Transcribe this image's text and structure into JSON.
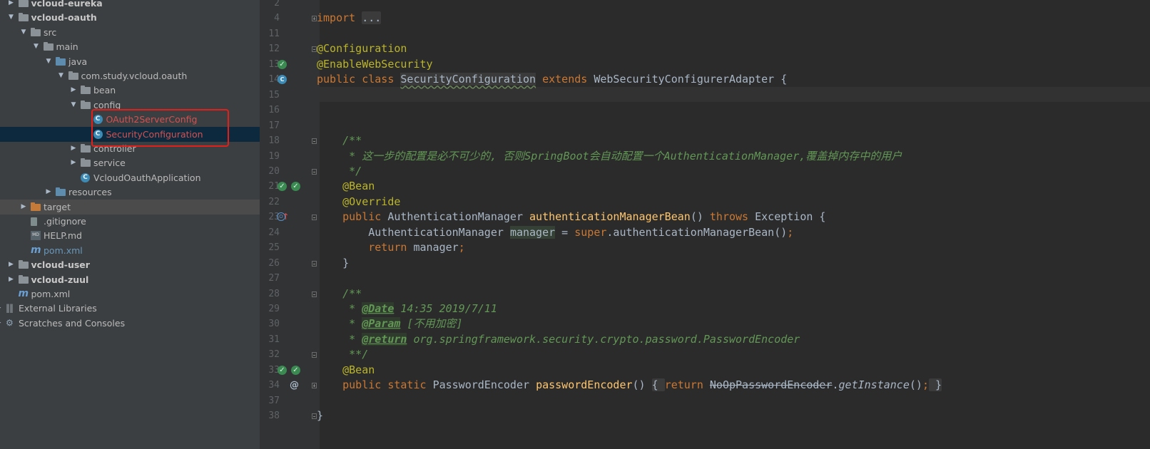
{
  "project_tree": {
    "items": [
      {
        "label": "vcloud-eureka",
        "depth": 0,
        "expanded": false,
        "icon": "module-folder-icon",
        "bold": true
      },
      {
        "label": "vcloud-oauth",
        "depth": 0,
        "expanded": true,
        "icon": "module-folder-icon",
        "bold": true
      },
      {
        "label": "src",
        "depth": 1,
        "expanded": true,
        "icon": "folder-icon"
      },
      {
        "label": "main",
        "depth": 2,
        "expanded": true,
        "icon": "folder-icon"
      },
      {
        "label": "java",
        "depth": 3,
        "expanded": true,
        "icon": "source-folder-icon"
      },
      {
        "label": "com.study.vcloud.oauth",
        "depth": 4,
        "expanded": true,
        "icon": "package-icon"
      },
      {
        "label": "bean",
        "depth": 5,
        "expanded": false,
        "icon": "package-icon"
      },
      {
        "label": "config",
        "depth": 5,
        "expanded": true,
        "icon": "package-icon"
      },
      {
        "label": "OAuth2ServerConfig",
        "depth": 6,
        "icon": "class-icon",
        "modified": true
      },
      {
        "label": "SecurityConfiguration",
        "depth": 6,
        "icon": "class-icon",
        "modified": true,
        "selected": true
      },
      {
        "label": "controller",
        "depth": 5,
        "expanded": false,
        "icon": "package-icon"
      },
      {
        "label": "service",
        "depth": 5,
        "expanded": false,
        "icon": "package-icon"
      },
      {
        "label": "VcloudOauthApplication",
        "depth": 5,
        "icon": "spring-boot-class-icon"
      },
      {
        "label": "resources",
        "depth": 3,
        "expanded": false,
        "icon": "resources-folder-icon"
      },
      {
        "label": "target",
        "depth": 1,
        "expanded": false,
        "icon": "excluded-folder-icon",
        "highlighted": true
      },
      {
        "label": ".gitignore",
        "depth": 1,
        "icon": "text-file-icon"
      },
      {
        "label": "HELP.md",
        "depth": 1,
        "icon": "markdown-file-icon"
      },
      {
        "label": "pom.xml",
        "depth": 1,
        "icon": "maven-icon",
        "blue": true
      },
      {
        "label": "vcloud-user",
        "depth": 0,
        "expanded": false,
        "icon": "module-folder-icon",
        "bold": true
      },
      {
        "label": "vcloud-zuul",
        "depth": 0,
        "expanded": false,
        "icon": "module-folder-icon",
        "bold": true
      },
      {
        "label": "pom.xml",
        "depth": 0,
        "icon": "maven-icon"
      },
      {
        "label": "External Libraries",
        "depth": -1,
        "expanded": false,
        "icon": "libraries-icon"
      },
      {
        "label": "Scratches and Consoles",
        "depth": -1,
        "expanded": false,
        "icon": "scratches-icon"
      }
    ]
  },
  "editor": {
    "lines": [
      {
        "num": "2",
        "code": []
      },
      {
        "num": "4",
        "code": [
          [
            "kw",
            "import "
          ],
          [
            "fold",
            "..."
          ]
        ],
        "fold": "plus"
      },
      {
        "num": "11",
        "code": []
      },
      {
        "num": "12",
        "code": [
          [
            "ann",
            "@Configuration"
          ]
        ],
        "fold": "minus"
      },
      {
        "num": "13",
        "code": [
          [
            "ann",
            "@EnableWebSecurity"
          ]
        ],
        "gutter": [
          "bean"
        ]
      },
      {
        "num": "14",
        "code": [
          [
            "kw",
            "public class "
          ],
          [
            "ul",
            "SecurityConfiguration"
          ],
          [
            "kw",
            " extends "
          ],
          [
            "t",
            "WebSecurityConfigurerAdapter {"
          ]
        ],
        "gutter": [
          "cls"
        ],
        "current": true
      },
      {
        "num": "15",
        "code": []
      },
      {
        "num": "16",
        "code": []
      },
      {
        "num": "17",
        "code": []
      },
      {
        "num": "18",
        "code": [
          [
            "t",
            "    "
          ],
          [
            "c",
            "/**"
          ]
        ],
        "fold": "minus"
      },
      {
        "num": "19",
        "code": [
          [
            "t",
            "     "
          ],
          [
            "c",
            "* 这一步的配置是必不可少的, 否则SpringBoot会自动配置一个AuthenticationManager,覆盖掉内存中的用户"
          ]
        ]
      },
      {
        "num": "20",
        "code": [
          [
            "t",
            "     "
          ],
          [
            "c",
            "*/"
          ]
        ],
        "fold": "minus"
      },
      {
        "num": "21",
        "code": [
          [
            "t",
            "    "
          ],
          [
            "ann",
            "@Bean"
          ]
        ],
        "gutter": [
          "bean",
          "bean2"
        ]
      },
      {
        "num": "22",
        "code": [
          [
            "t",
            "    "
          ],
          [
            "ann",
            "@Override"
          ]
        ]
      },
      {
        "num": "23",
        "code": [
          [
            "t",
            "    "
          ],
          [
            "kw",
            "public "
          ],
          [
            "t",
            "AuthenticationManager "
          ],
          [
            "m",
            "authenticationManagerBean"
          ],
          [
            "t",
            "() "
          ],
          [
            "kw",
            "throws "
          ],
          [
            "t",
            "Exception {"
          ]
        ],
        "gutter": [
          "ov",
          "up"
        ],
        "fold": "minus"
      },
      {
        "num": "24",
        "code": [
          [
            "t",
            "        AuthenticationManager "
          ],
          [
            "hv",
            "manager"
          ],
          [
            "t",
            " = "
          ],
          [
            "kw",
            "super"
          ],
          [
            "t",
            ".authenticationManagerBean()"
          ],
          [
            "kw",
            ";"
          ]
        ]
      },
      {
        "num": "25",
        "code": [
          [
            "t",
            "        "
          ],
          [
            "kw",
            "return "
          ],
          [
            "t",
            "manager"
          ],
          [
            "kw",
            ";"
          ]
        ]
      },
      {
        "num": "26",
        "code": [
          [
            "t",
            "    }"
          ]
        ],
        "fold": "minus"
      },
      {
        "num": "27",
        "code": []
      },
      {
        "num": "28",
        "code": [
          [
            "t",
            "    "
          ],
          [
            "c",
            "/**"
          ]
        ],
        "fold": "minus"
      },
      {
        "num": "29",
        "code": [
          [
            "t",
            "     "
          ],
          [
            "c",
            "* "
          ],
          [
            "tag",
            "@Date"
          ],
          [
            "c",
            " 14:35 2019/7/11"
          ]
        ]
      },
      {
        "num": "30",
        "code": [
          [
            "t",
            "     "
          ],
          [
            "c",
            "* "
          ],
          [
            "tag",
            "@Param"
          ],
          [
            "c",
            " [不用加密]"
          ]
        ]
      },
      {
        "num": "31",
        "code": [
          [
            "t",
            "     "
          ],
          [
            "c",
            "* "
          ],
          [
            "tag",
            "@return"
          ],
          [
            "c",
            " org.springframework.security.crypto.password.PasswordEncoder"
          ]
        ]
      },
      {
        "num": "32",
        "code": [
          [
            "t",
            "     "
          ],
          [
            "c",
            "**/"
          ]
        ],
        "fold": "minus"
      },
      {
        "num": "33",
        "code": [
          [
            "t",
            "    "
          ],
          [
            "ann",
            "@Bean"
          ]
        ],
        "gutter": [
          "bean",
          "bean2"
        ]
      },
      {
        "num": "34",
        "code": [
          [
            "t",
            "    "
          ],
          [
            "kw",
            "public static "
          ],
          [
            "t",
            "PasswordEncoder "
          ],
          [
            "m",
            "passwordEncoder"
          ],
          [
            "t",
            "() "
          ],
          [
            "fold",
            "{ "
          ],
          [
            "kw",
            "return "
          ],
          [
            "dep",
            "NoOpPasswordEncoder"
          ],
          [
            "t",
            "."
          ],
          [
            "si",
            "getInstance"
          ],
          [
            "t",
            "()"
          ],
          [
            "kw",
            ";"
          ],
          [
            "fold",
            " }"
          ]
        ],
        "gutter": [
          "at"
        ],
        "fold": "plus"
      },
      {
        "num": "37",
        "code": []
      },
      {
        "num": "38",
        "code": [
          [
            "t",
            "}"
          ]
        ],
        "fold": "minus"
      }
    ]
  }
}
